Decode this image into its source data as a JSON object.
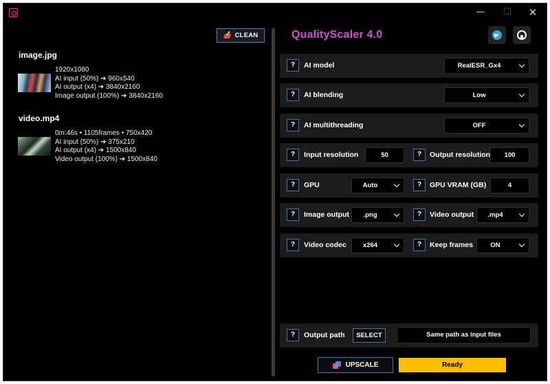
{
  "window": {
    "controls": {
      "minimize": "—",
      "maximize": "☐",
      "close": "✕"
    },
    "icon": "app-logo-icon"
  },
  "left": {
    "clean_label": "CLEAN",
    "files": [
      {
        "name": "image.jpg",
        "info": [
          "1920x1080",
          "AI input (50%) ➔ 960x540",
          "AI output (x4) ➔ 3840x2160",
          "Image output (100%) ➔ 3840x2160"
        ]
      },
      {
        "name": "video.mp4",
        "info": [
          "0m:46s • 1105frames • 750x420",
          "AI input (50%) ➔ 375x210",
          "AI output (x4) ➔ 1500x840",
          "Video output (100%) ➔ 1500x840"
        ]
      }
    ]
  },
  "right": {
    "title": "QualityScaler 4.0",
    "social": [
      "telegram-icon",
      "github-icon"
    ],
    "help_glyph": "?",
    "ai_model": {
      "label": "AI model",
      "value": "RealESR_Gx4"
    },
    "ai_blending": {
      "label": "AI blending",
      "value": "Low"
    },
    "ai_multithreading": {
      "label": "AI multithreading",
      "value": "OFF"
    },
    "input_resolution": {
      "label": "Input resolution",
      "value": "50"
    },
    "output_resolution": {
      "label": "Output resolution",
      "value": "100"
    },
    "gpu": {
      "label": "GPU",
      "value": "Auto"
    },
    "gpu_vram": {
      "label": "GPU VRAM (GB)",
      "value": "4"
    },
    "image_output": {
      "label": "Image output",
      "value": ".png"
    },
    "video_output": {
      "label": "Video output",
      "value": ".mp4"
    },
    "video_codec": {
      "label": "Video codec",
      "value": "x264"
    },
    "keep_frames": {
      "label": "Keep frames",
      "value": "ON"
    },
    "output_path": {
      "label": "Output path",
      "select_label": "SELECT",
      "value": "Same path as input files"
    },
    "upscale_label": "UPSCALE",
    "status": "Ready"
  },
  "colors": {
    "title": "#d24fd6",
    "accent_border": "#3d77b8",
    "status": "#ffbf00"
  }
}
